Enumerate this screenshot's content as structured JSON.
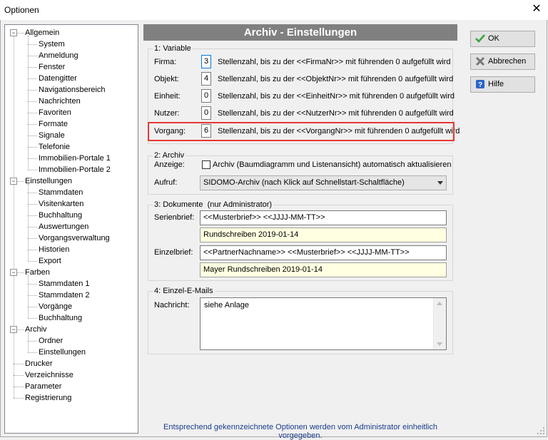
{
  "window": {
    "title": "Optionen"
  },
  "tree": [
    {
      "label": "Allgemein",
      "level": 0,
      "toggle": "−"
    },
    {
      "label": "System",
      "level": 1
    },
    {
      "label": "Anmeldung",
      "level": 1
    },
    {
      "label": "Fenster",
      "level": 1
    },
    {
      "label": "Datengitter",
      "level": 1
    },
    {
      "label": "Navigationsbereich",
      "level": 1
    },
    {
      "label": "Nachrichten",
      "level": 1
    },
    {
      "label": "Favoriten",
      "level": 1
    },
    {
      "label": "Formate",
      "level": 1
    },
    {
      "label": "Signale",
      "level": 1
    },
    {
      "label": "Telefonie",
      "level": 1
    },
    {
      "label": "Immobilien-Portale 1",
      "level": 1
    },
    {
      "label": "Immobilien-Portale 2",
      "level": 1
    },
    {
      "label": "Einstellungen",
      "level": 0,
      "toggle": "−"
    },
    {
      "label": "Stammdaten",
      "level": 1
    },
    {
      "label": "Visitenkarten",
      "level": 1
    },
    {
      "label": "Buchhaltung",
      "level": 1
    },
    {
      "label": "Auswertungen",
      "level": 1
    },
    {
      "label": "Vorgangsverwaltung",
      "level": 1
    },
    {
      "label": "Historien",
      "level": 1
    },
    {
      "label": "Export",
      "level": 1
    },
    {
      "label": "Farben",
      "level": 0,
      "toggle": "−"
    },
    {
      "label": "Stammdaten 1",
      "level": 1
    },
    {
      "label": "Stammdaten 2",
      "level": 1
    },
    {
      "label": "Vorgänge",
      "level": 1
    },
    {
      "label": "Buchhaltung",
      "level": 1
    },
    {
      "label": "Archiv",
      "level": 0,
      "toggle": "−"
    },
    {
      "label": "Ordner",
      "level": 1
    },
    {
      "label": "Einstellungen",
      "level": 1
    },
    {
      "label": "Drucker",
      "level": 0
    },
    {
      "label": "Verzeichnisse",
      "level": 0
    },
    {
      "label": "Parameter",
      "level": 0
    },
    {
      "label": "Registrierung",
      "level": 0
    }
  ],
  "header": {
    "title": "Archiv - Einstellungen"
  },
  "variable": {
    "title": "1: Variable",
    "rows": [
      {
        "label": "Firma:",
        "value": "3",
        "desc": "Stellenzahl, bis zu der <<FirmaNr>> mit führenden 0 aufgefüllt wird"
      },
      {
        "label": "Objekt:",
        "value": "4",
        "desc": "Stellenzahl, bis zu der <<ObjektNr>> mit führenden 0 aufgefüllt wird"
      },
      {
        "label": "Einheit:",
        "value": "0",
        "desc": "Stellenzahl, bis zu der <<EinheitNr>> mit führenden 0 aufgefüllt wird"
      },
      {
        "label": "Nutzer:",
        "value": "0",
        "desc": "Stellenzahl, bis zu der <<NutzerNr>> mit führenden 0 aufgefüllt wird"
      },
      {
        "label": "Vorgang:",
        "value": "6",
        "desc": "Stellenzahl, bis zu der <<VorgangNr>> mit führenden 0 aufgefüllt wird"
      }
    ]
  },
  "archiv": {
    "title": "2: Archiv",
    "anzeige_label": "Anzeige:",
    "anzeige_checkbox": "Archiv (Baumdiagramm und Listenansicht) automatisch aktualisieren",
    "anzeige_checked": false,
    "aufruf_label": "Aufruf:",
    "aufruf_value": "SIDOMO-Archiv (nach Klick auf Schnellstart-Schaltfläche)"
  },
  "dokumente": {
    "title": "3: Dokumente  (nur Administrator)",
    "serienbrief_label": "Serienbrief:",
    "serienbrief_value": "<<Musterbrief>> <<JJJJ-MM-TT>>",
    "serienbrief_preview": "Rundschreiben 2019-01-14",
    "einzelbrief_label": "Einzelbrief:",
    "einzelbrief_value": "<<PartnerNachname>> <<Musterbrief>> <<JJJJ-MM-TT>>",
    "einzelbrief_preview": "Mayer Rundschreiben 2019-01-14"
  },
  "emails": {
    "title": "4: Einzel-E-Mails",
    "nachricht_label": "Nachricht:",
    "nachricht_value": "siehe Anlage"
  },
  "buttons": {
    "ok": "OK",
    "cancel": "Abbrechen",
    "help": "Hilfe"
  },
  "footer": "Entsprechend gekennzeichnete Optionen werden vom Administrator einheitlich vorgegeben.",
  "colors": {
    "header_bg": "#808080",
    "highlight": "#e53935",
    "preview_bg": "#ffffe1",
    "footer_text": "#1a3c8c"
  }
}
